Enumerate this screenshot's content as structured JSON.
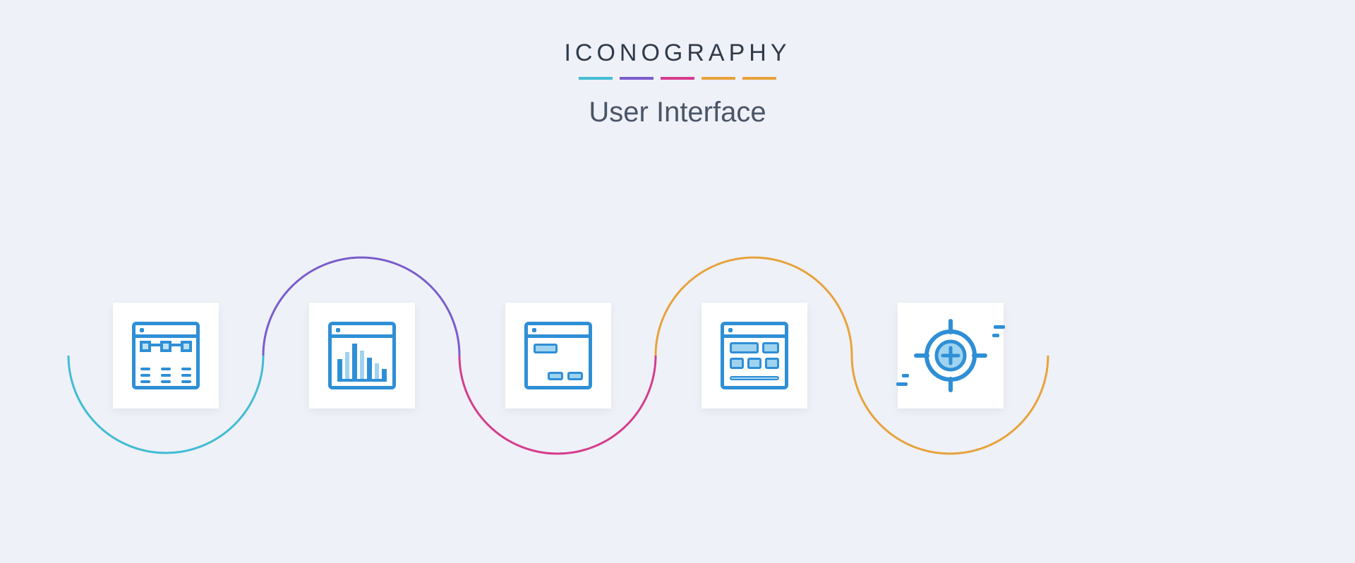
{
  "header": {
    "brand": "ICONOGRAPHY",
    "subtitle": "User Interface",
    "underline_colors": [
      "#42bcd4",
      "#7a5ccc",
      "#d53c8e",
      "#e8a23b",
      "#e8a23b"
    ]
  },
  "wave_colors": {
    "arc1": "#42bcd4",
    "arc2": "#7a5ccc",
    "arc3": "#d53c8e",
    "arc4": "#e8a23b",
    "arc5": "#e8a23b"
  },
  "icons": [
    {
      "name": "sitemap-columns-icon"
    },
    {
      "name": "bar-chart-window-icon"
    },
    {
      "name": "form-dialog-window-icon"
    },
    {
      "name": "layout-grid-window-icon"
    },
    {
      "name": "target-crosshair-icon"
    }
  ]
}
